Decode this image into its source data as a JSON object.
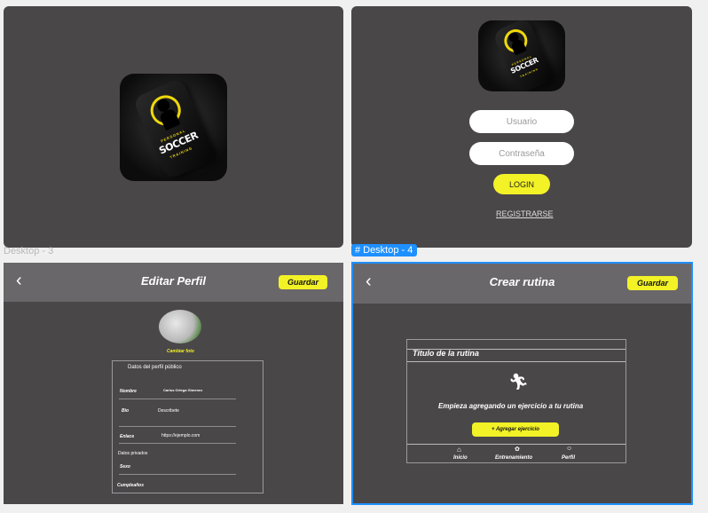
{
  "frames": {
    "splash": {
      "label": "Desktop - 3"
    },
    "login": {
      "label": "Desktop - 4",
      "user_placeholder": "Usuario",
      "pass_placeholder": "Contraseña",
      "login_label": "LOGIN",
      "register_label": "REGISTRARSE"
    },
    "edit_profile": {
      "title": "Editar Perfil",
      "save_label": "Guardar",
      "change_photo": "Cambiar foto",
      "section_public": "Datos del perfil público",
      "name_label": "Nombre",
      "name_value": "Carlos Ortega Gimenez",
      "bio_label": "Bio",
      "bio_value": "Describete",
      "link_label": "Enlace",
      "link_value": "https://ejemplo.com",
      "section_private": "Datos privados",
      "sex_label": "Sexo",
      "birthday_label": "Cumpleaños"
    },
    "create_routine": {
      "title": "Crear rutina",
      "save_label": "Guardar",
      "routine_title": "Titulo de la rutina",
      "empty_text": "Empieza agregando un ejercicio a tu rutina",
      "add_label": "+ Agregar ejercicio",
      "nav": [
        "Inicio",
        "Entrenamiento",
        "Perfil"
      ]
    }
  },
  "logo": {
    "line1": "PERSONAL",
    "line2": "SOCCER",
    "line3": "TRAINING"
  },
  "colors": {
    "accent_yellow": "#f2f227",
    "frame_bg": "#4a4749",
    "header_bg": "#6a676a",
    "selection_blue": "#1e90ff"
  }
}
